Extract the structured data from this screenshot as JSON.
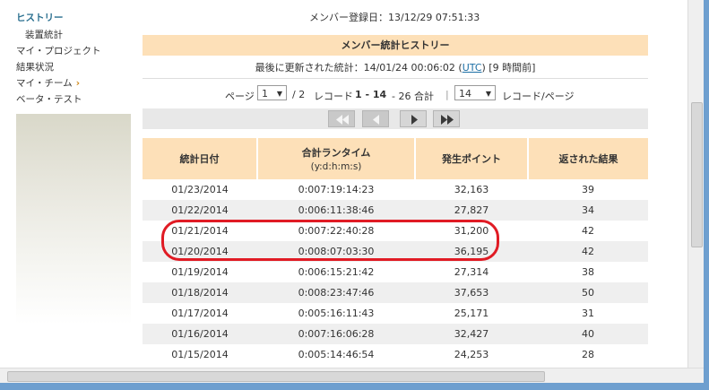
{
  "sidebar": {
    "items": [
      {
        "label": "ヒストリー"
      },
      {
        "label": "装置統計"
      },
      {
        "label": "マイ・プロジェクト"
      },
      {
        "label": "結果状況"
      },
      {
        "label": "マイ・チーム"
      },
      {
        "label": "ベータ・テスト"
      }
    ],
    "chevron": "›"
  },
  "member": {
    "registered": "メンバー登録日：13/12/29 07:51:33"
  },
  "stats": {
    "title": "メンバー統計ヒストリー",
    "updated_prefix": "最後に更新された統計：14/01/24 00:06:02 (",
    "utc": "UTC",
    "updated_suffix": ") [9 時間前]"
  },
  "pager": {
    "page_label": "ページ",
    "page_value": "1",
    "page_total": "/ 2",
    "record_prefix": "レコード",
    "record_range": "1 - 14",
    "record_total": "- 26 合計",
    "per_page_value": "14",
    "per_page_label": "レコード/ページ",
    "separator": "|"
  },
  "table": {
    "headers": [
      {
        "label": "統計日付",
        "sub": ""
      },
      {
        "label": "合計ランタイム",
        "sub": "(y:d:h:m:s)"
      },
      {
        "label": "発生ポイント",
        "sub": ""
      },
      {
        "label": "返された結果",
        "sub": ""
      }
    ],
    "rows": [
      {
        "date": "01/23/2014",
        "runtime": "0:007:19:14:23",
        "points": "32,163",
        "results": "39"
      },
      {
        "date": "01/22/2014",
        "runtime": "0:006:11:38:46",
        "points": "27,827",
        "results": "34"
      },
      {
        "date": "01/21/2014",
        "runtime": "0:007:22:40:28",
        "points": "31,200",
        "results": "42"
      },
      {
        "date": "01/20/2014",
        "runtime": "0:008:07:03:30",
        "points": "36,195",
        "results": "42"
      },
      {
        "date": "01/19/2014",
        "runtime": "0:006:15:21:42",
        "points": "27,314",
        "results": "38"
      },
      {
        "date": "01/18/2014",
        "runtime": "0:008:23:47:46",
        "points": "37,653",
        "results": "50"
      },
      {
        "date": "01/17/2014",
        "runtime": "0:005:16:11:43",
        "points": "25,171",
        "results": "31"
      },
      {
        "date": "01/16/2014",
        "runtime": "0:007:16:06:28",
        "points": "32,427",
        "results": "40"
      },
      {
        "date": "01/15/2014",
        "runtime": "0:005:14:46:54",
        "points": "24,253",
        "results": "28"
      }
    ]
  },
  "colors": {
    "header_bg": "#fde0b8",
    "highlight": "#e01b24",
    "link": "#1d6fa5"
  }
}
